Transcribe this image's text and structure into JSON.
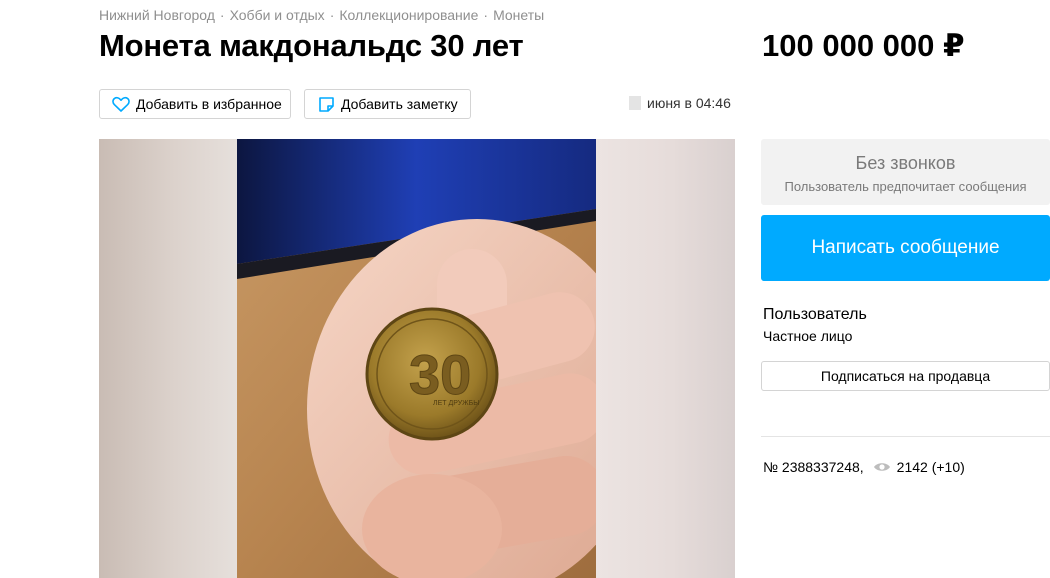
{
  "breadcrumb": [
    "Нижний Новгород",
    "Хобби и отдых",
    "Коллекционирование",
    "Монеты"
  ],
  "title": "Монета макдональдс 30 лет",
  "price": "100 000 000 ₽",
  "actions": {
    "favorite_label": "Добавить в избранное",
    "note_label": "Добавить заметку"
  },
  "date": "июня в 04:46",
  "gallery": {
    "coin_text": "ЛЕТ ДРУЖБЫ"
  },
  "contact": {
    "no_calls_title": "Без звонков",
    "no_calls_subtitle": "Пользователь предпочитает сообщения",
    "message_button": "Написать сообщение"
  },
  "seller": {
    "name": "Пользователь",
    "type": "Частное лицо",
    "subscribe_label": "Подписаться на продавца"
  },
  "stats": {
    "ad_number": "№ 2388337248,",
    "views": "2142 (+10)"
  },
  "colors": {
    "accent": "#00aaff",
    "muted_text": "#8f8f8f",
    "heart": "#00aaff",
    "note": "#00aaff"
  },
  "icons": [
    "heart-icon",
    "note-icon",
    "eye-icon"
  ]
}
